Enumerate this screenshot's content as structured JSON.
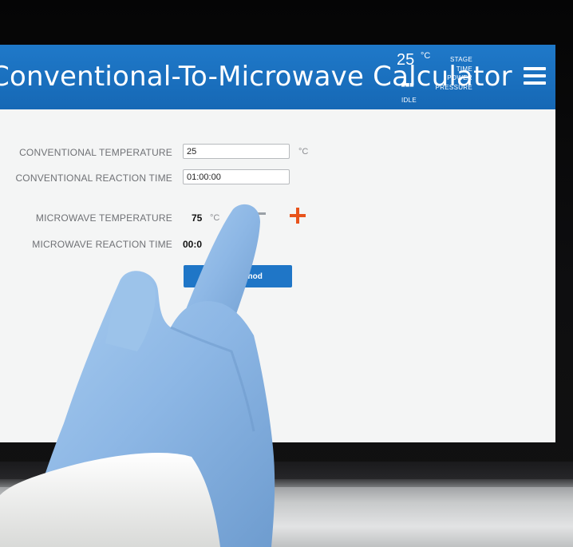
{
  "app": {
    "title": "Conventional-To-Microwave Calculator"
  },
  "status": {
    "temperature": "25",
    "temperature_unit": "°C",
    "dots": "▪▪▪",
    "state": "IDLE",
    "items": [
      "STAGE",
      "TIME",
      "POWER",
      "PRESSURE"
    ]
  },
  "form": {
    "conv_temp_label": "CONVENTIONAL TEMPERATURE",
    "conv_temp_value": "25",
    "conv_temp_unit": "°C",
    "conv_time_label": "CONVENTIONAL REACTION TIME",
    "conv_time_value": "01:00:00",
    "mw_temp_label": "MICROWAVE TEMPERATURE",
    "mw_temp_value": "75",
    "mw_temp_unit": "°C",
    "mw_time_label": "MICROWAVE REACTION TIME",
    "mw_time_value": "00:0",
    "method_button": "thod"
  },
  "colors": {
    "header_blue": "#1f79c9",
    "plus_orange": "#e8531b",
    "glove_blue": "#8fb8e6",
    "sleeve_white": "#f2f2f0"
  }
}
